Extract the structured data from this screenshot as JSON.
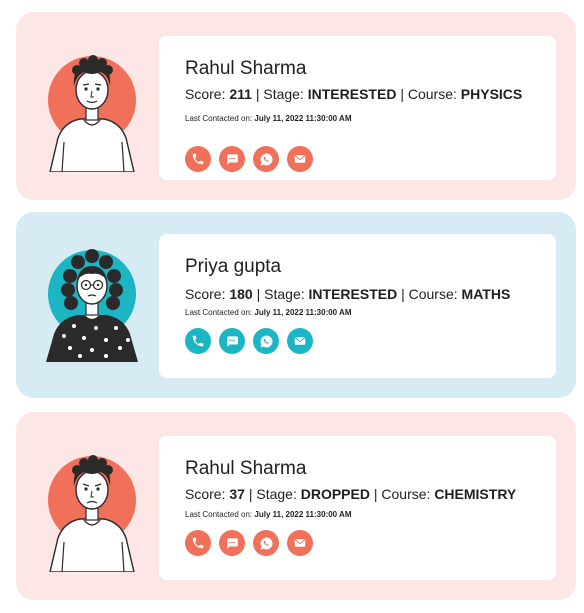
{
  "leads": [
    {
      "name": "Rahul Sharma",
      "score_label": "Score:",
      "score": "211",
      "stage_label": "Stage:",
      "stage": "INTERESTED",
      "course_label": "Course:",
      "course": "PHYSICS",
      "last_contacted_label": "Last Contacted on:",
      "last_contacted": "July 11, 2022 11:30:00 AM",
      "theme": "pink",
      "accent": "#f0705a"
    },
    {
      "name": "Priya gupta",
      "score_label": "Score:",
      "score": "180",
      "stage_label": "Stage:",
      "stage": "INTERESTED",
      "course_label": "Course:",
      "course": "MATHS",
      "last_contacted_label": "Last Contacted on:",
      "last_contacted": "July 11, 2022 11:30:00 AM",
      "theme": "blue",
      "accent": "#1bb5c3"
    },
    {
      "name": "Rahul Sharma",
      "score_label": "Score:",
      "score": "37",
      "stage_label": "Stage:",
      "stage": "DROPPED",
      "course_label": "Course:",
      "course": "CHEMISTRY",
      "last_contacted_label": "Last Contacted on:",
      "last_contacted": "July 11, 2022 11:30:00 AM",
      "theme": "pink",
      "accent": "#f0705a"
    }
  ],
  "action_icons": [
    "phone-icon",
    "chat-icon",
    "whatsapp-icon",
    "mail-icon"
  ],
  "colors": {
    "pink_card_bg": "#fde6e6",
    "blue_card_bg": "#d6ebf3",
    "info_bg": "#ffffff"
  }
}
